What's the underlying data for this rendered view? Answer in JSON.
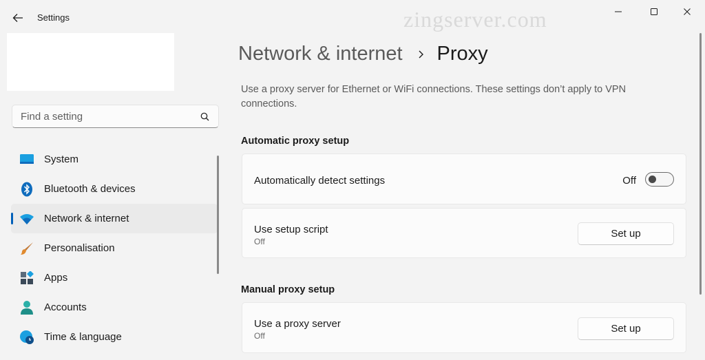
{
  "window": {
    "title": "Settings",
    "watermark": "zingserver.com"
  },
  "sidebar": {
    "search_placeholder": "Find a setting",
    "items": [
      {
        "label": "System",
        "icon": "system-icon",
        "active": false
      },
      {
        "label": "Bluetooth & devices",
        "icon": "bluetooth-icon",
        "active": false
      },
      {
        "label": "Network & internet",
        "icon": "wifi-icon",
        "active": true
      },
      {
        "label": "Personalisation",
        "icon": "brush-icon",
        "active": false
      },
      {
        "label": "Apps",
        "icon": "apps-icon",
        "active": false
      },
      {
        "label": "Accounts",
        "icon": "person-icon",
        "active": false
      },
      {
        "label": "Time & language",
        "icon": "globe-clock-icon",
        "active": false
      }
    ]
  },
  "main": {
    "breadcrumb": {
      "parent": "Network & internet",
      "current": "Proxy"
    },
    "description": "Use a proxy server for Ethernet or WiFi connections. These settings don’t apply to VPN connections.",
    "automatic": {
      "title": "Automatic proxy setup",
      "detect": {
        "label": "Automatically detect settings",
        "state": "Off"
      },
      "script": {
        "label": "Use setup script",
        "sub": "Off",
        "button": "Set up"
      }
    },
    "manual": {
      "title": "Manual proxy setup",
      "proxy": {
        "label": "Use a proxy server",
        "sub": "Off",
        "button": "Set up"
      }
    }
  },
  "colors": {
    "accent": "#005fb8",
    "background": "#f3f3f3",
    "card": "#fbfbfb"
  }
}
